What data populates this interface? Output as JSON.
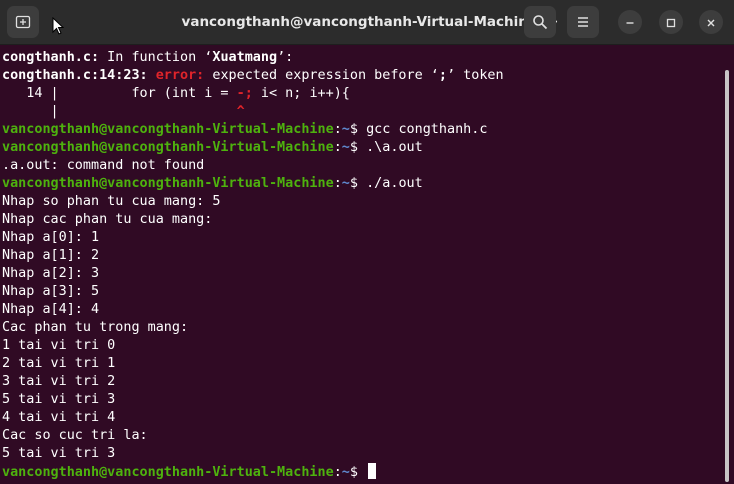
{
  "window": {
    "title": "vancongthanh@vancongthanh-Virtual-Machine: ~",
    "icons": {
      "new_tab": "new-tab-icon",
      "search": "search-icon",
      "menu": "hamburger-menu-icon",
      "minimize": "minimize-icon",
      "maximize": "maximize-icon",
      "close": "close-icon"
    }
  },
  "colors": {
    "background": "#300a24",
    "prompt_user": "#4eb20e",
    "prompt_path": "#5f8ad0",
    "error": "#e0242a"
  },
  "terminal": {
    "l1": {
      "file": "congthanh.c:",
      "msg": " In function ‘",
      "fn": "Xuatmang",
      "end": "’:"
    },
    "l2": {
      "loc": "congthanh.c:14:23:",
      "err": "error:",
      "msg": " expected expression before ‘",
      "tok": ";",
      "end": "’ token"
    },
    "l3": {
      "pre": "   14 |         for (int i = ",
      "bad": "-;",
      "post": " i< n; i++){"
    },
    "l4": {
      "pre": "      |                      ",
      "caret": "^"
    },
    "prompt": {
      "user": "vancongthanh@vancongthanh-Virtual-Machine",
      "path": "~",
      "sign": "$ "
    },
    "cmd1": "gcc congthanh.c",
    "cmd2": ".\\a.out",
    "out1": ".a.out: command not found",
    "cmd3": "./a.out",
    "output": [
      "Nhap so phan tu cua mang: 5",
      "Nhap cac phan tu cua mang:",
      "Nhap a[0]: 1",
      "Nhap a[1]: 2",
      "Nhap a[2]: 3",
      "Nhap a[3]: 5",
      "Nhap a[4]: 4",
      "Cac phan tu trong mang:",
      "1 tai vi tri 0",
      "2 tai vi tri 1",
      "3 tai vi tri 2",
      "5 tai vi tri 3",
      "4 tai vi tri 4",
      "Cac so cuc tri la:",
      "5 tai vi tri 3"
    ]
  }
}
